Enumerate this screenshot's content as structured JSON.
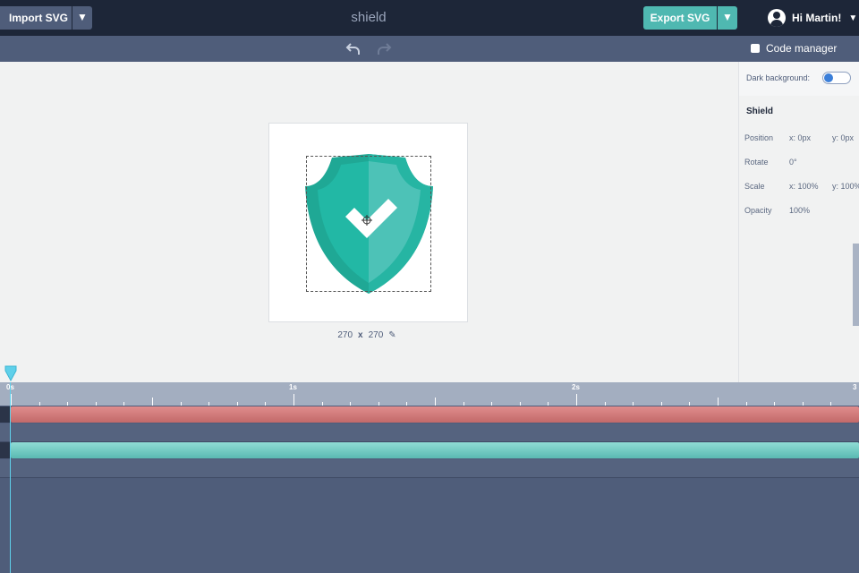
{
  "topbar": {
    "import_label": "Import SVG",
    "title": "shield",
    "export_label": "Export SVG",
    "user_greeting": "Hi Martin!"
  },
  "right_panel": {
    "code_manager_label": "Code manager",
    "dark_background_label": "Dark background:",
    "dark_background_on": false,
    "section_title": "Shield",
    "properties": {
      "position": {
        "label": "Position",
        "x": "x: 0px",
        "y": "y: 0px"
      },
      "rotate": {
        "label": "Rotate",
        "value": "0°"
      },
      "scale": {
        "label": "Scale",
        "x": "x: 100%",
        "y": "y: 100%"
      },
      "opacity": {
        "label": "Opacity",
        "value": "100%"
      }
    }
  },
  "canvas": {
    "width": "270",
    "separator": "x",
    "height": "270"
  },
  "timeline": {
    "labels": [
      "0s",
      "1s",
      "2s",
      "3"
    ],
    "tracks": [
      {
        "color": "#d07a7a"
      },
      {
        "color": "#6fcac3"
      }
    ]
  },
  "colors": {
    "accent": "#4fb8b1",
    "topbar": "#1d2638",
    "panel": "#4f5d7a",
    "shield_dark": "#1fa895",
    "shield_light": "#4dc2b7"
  }
}
